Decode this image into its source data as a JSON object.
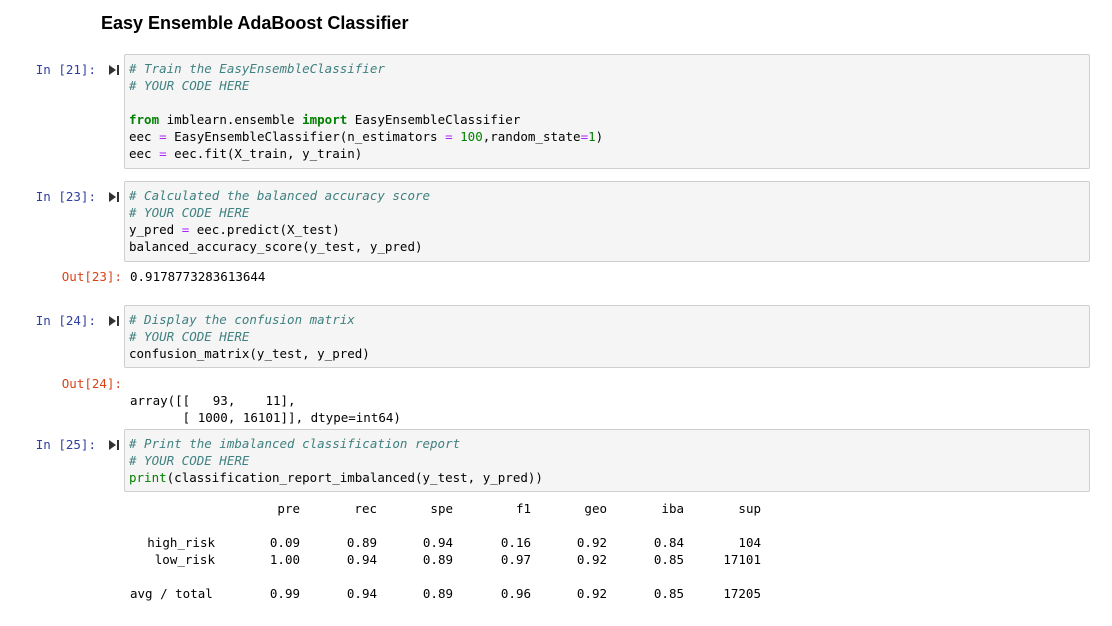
{
  "heading": "Easy Ensemble AdaBoost Classifier",
  "cells": [
    {
      "prompt": "In [21]:",
      "lines": [
        "# Train the EasyEnsembleClassifier",
        "# YOUR CODE HERE",
        "",
        "from imblearn.ensemble import EasyEnsembleClassifier",
        "eec = EasyEnsembleClassifier(n_estimators = 100,random_state=1)",
        "eec = eec.fit(X_train, y_train)"
      ]
    },
    {
      "prompt": "In [23]:",
      "lines": [
        "# Calculated the balanced accuracy score",
        "# YOUR CODE HERE",
        "y_pred = eec.predict(X_test)",
        "balanced_accuracy_score(y_test, y_pred)"
      ],
      "out_prompt": "Out[23]:",
      "output": "0.9178773283613644"
    },
    {
      "prompt": "In [24]:",
      "lines": [
        "# Display the confusion matrix",
        "# YOUR CODE HERE",
        "confusion_matrix(y_test, y_pred)"
      ],
      "out_prompt": "Out[24]:",
      "output_lines": [
        "array([[   93,    11],",
        "       [ 1000, 16101]], dtype=int64)"
      ]
    },
    {
      "prompt": "In [25]:",
      "lines": [
        "# Print the imbalanced classification report",
        "# YOUR CODE HERE",
        "print(classification_report_imbalanced(y_test, y_pred))"
      ]
    }
  ],
  "report": {
    "headers": [
      "pre",
      "rec",
      "spe",
      "f1",
      "geo",
      "iba",
      "sup"
    ],
    "rows": [
      {
        "label": "high_risk",
        "values": [
          "0.09",
          "0.89",
          "0.94",
          "0.16",
          "0.92",
          "0.84",
          "104"
        ]
      },
      {
        "label": "low_risk",
        "values": [
          "1.00",
          "0.94",
          "0.89",
          "0.97",
          "0.92",
          "0.85",
          "17101"
        ]
      }
    ],
    "total": {
      "label": "avg / total",
      "values": [
        "0.99",
        "0.94",
        "0.89",
        "0.96",
        "0.92",
        "0.85",
        "17205"
      ]
    }
  }
}
